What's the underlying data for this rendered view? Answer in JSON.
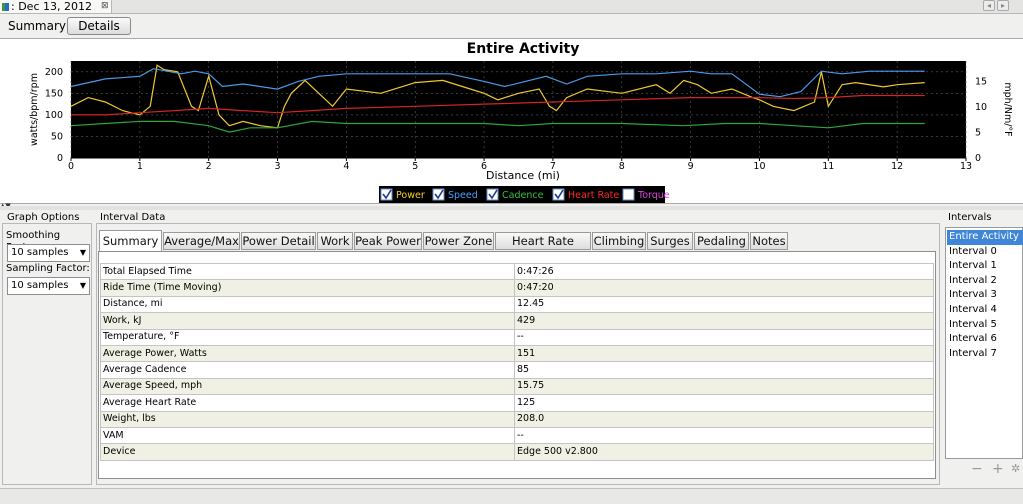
{
  "doc_tab": {
    "title": ": Dec 13, 2012",
    "close_glyph": "⊠"
  },
  "nav": {
    "back_glyph": "◂",
    "forward_glyph": "▸"
  },
  "view_toggle": {
    "summary_label": "Summary",
    "details_label": "Details"
  },
  "chart_data": {
    "type": "line",
    "title": "Entire Activity",
    "xlabel": "Distance (mi)",
    "ylabel_left": "watts/bpm/rpm",
    "ylabel_right": "mph/Nm/°F",
    "x_ticks": [
      0,
      1,
      2,
      3,
      4,
      5,
      6,
      7,
      8,
      9,
      10,
      11,
      12,
      13
    ],
    "y_left_ticks": [
      0,
      50,
      100,
      150,
      200
    ],
    "y_right_ticks": [
      0,
      5,
      10,
      15
    ],
    "xlim": [
      0,
      13
    ],
    "ylim_left": [
      0,
      225
    ],
    "ylim_right": [
      0,
      19
    ],
    "background": "#000000",
    "grid": true,
    "legend_placement": "bottom-center",
    "legend": [
      {
        "label": "Power",
        "checked": true,
        "color": "#f5d02a"
      },
      {
        "label": "Speed",
        "checked": true,
        "color": "#4aa0ff"
      },
      {
        "label": "Cadence",
        "checked": true,
        "color": "#32c040"
      },
      {
        "label": "Heart Rate",
        "checked": true,
        "color": "#ff2a2a"
      },
      {
        "label": "Torque",
        "checked": false,
        "color": "#e040e0"
      }
    ],
    "series": [
      {
        "name": "Power",
        "axis": "left",
        "color": "#f0c830",
        "x": [
          0,
          0.25,
          0.5,
          0.75,
          1.0,
          1.15,
          1.25,
          1.35,
          1.55,
          1.75,
          1.85,
          2.0,
          2.15,
          2.3,
          2.5,
          2.75,
          3.0,
          3.1,
          3.2,
          3.4,
          3.6,
          3.8,
          4.0,
          4.5,
          5.0,
          5.4,
          5.8,
          6.0,
          6.2,
          6.5,
          6.8,
          6.95,
          7.05,
          7.2,
          7.5,
          8.0,
          8.5,
          8.7,
          8.9,
          9.1,
          9.3,
          9.6,
          9.9,
          10.0,
          10.2,
          10.5,
          10.8,
          10.9,
          11.0,
          11.2,
          11.4,
          11.8,
          12.0,
          12.4
        ],
        "y": [
          120,
          140,
          130,
          110,
          100,
          120,
          215,
          205,
          200,
          120,
          110,
          190,
          100,
          75,
          85,
          75,
          70,
          120,
          150,
          180,
          150,
          120,
          160,
          150,
          175,
          180,
          160,
          150,
          135,
          150,
          160,
          120,
          110,
          140,
          160,
          150,
          170,
          150,
          180,
          170,
          150,
          160,
          140,
          135,
          120,
          110,
          130,
          200,
          120,
          170,
          175,
          165,
          170,
          175
        ]
      },
      {
        "name": "Speed",
        "axis": "right",
        "color": "#4a9ae8",
        "x": [
          0,
          0.5,
          1.0,
          1.2,
          1.4,
          1.6,
          1.8,
          2.0,
          2.2,
          2.5,
          3.0,
          3.3,
          3.6,
          4.0,
          4.5,
          5.0,
          5.5,
          6.0,
          6.3,
          6.6,
          6.9,
          7.2,
          7.5,
          8.0,
          8.5,
          9.0,
          9.3,
          9.6,
          10.0,
          10.3,
          10.6,
          10.9,
          11.2,
          11.6,
          12.0,
          12.4
        ],
        "y": [
          14,
          15.5,
          16,
          17.5,
          17,
          16.5,
          17,
          16.5,
          14,
          14.5,
          13.5,
          15,
          16,
          16.5,
          16.5,
          16.5,
          16.5,
          15,
          14,
          15,
          16,
          14.5,
          16,
          16.5,
          16.5,
          17,
          16.5,
          16.5,
          12.5,
          12,
          13,
          17,
          16.5,
          17,
          17,
          17
        ]
      },
      {
        "name": "Cadence",
        "axis": "left",
        "color": "#2ca63a",
        "x": [
          0,
          0.5,
          1.0,
          1.5,
          2.0,
          2.3,
          2.6,
          3.0,
          3.5,
          4.0,
          5.0,
          6.0,
          6.5,
          7.0,
          7.5,
          8.0,
          8.9,
          9.5,
          10.0,
          10.5,
          11.0,
          11.5,
          12.4
        ],
        "y": [
          75,
          80,
          85,
          85,
          75,
          60,
          70,
          70,
          85,
          80,
          80,
          80,
          75,
          80,
          80,
          80,
          75,
          80,
          80,
          75,
          70,
          80,
          80
        ]
      },
      {
        "name": "Heart Rate",
        "axis": "left",
        "color": "#d42424",
        "x": [
          0,
          0.5,
          1.0,
          1.5,
          2.0,
          2.5,
          3.0,
          3.5,
          4.0,
          5.0,
          6.0,
          7.0,
          8.0,
          9.0,
          10.0,
          10.5,
          11.0,
          11.5,
          12.0,
          12.4
        ],
        "y": [
          100,
          100,
          105,
          110,
          115,
          110,
          105,
          110,
          115,
          120,
          125,
          130,
          135,
          140,
          140,
          138,
          140,
          145,
          145,
          145
        ]
      }
    ]
  },
  "graph_options": {
    "header": "Graph Options",
    "smoothing_label": "Smoothing Factor:",
    "smoothing_value": "10 samples",
    "sampling_label": "Sampling Factor:",
    "sampling_value": "10 samples"
  },
  "interval_data": {
    "header": "Interval Data",
    "tabs": [
      "Summary",
      "Average/Max",
      "Power Detail",
      "Work",
      "Peak Power",
      "Power Zone",
      "Heart Rate Zone",
      "Climbing",
      "Surges",
      "Pedaling",
      "Notes"
    ],
    "rows": [
      {
        "label": "Total Elapsed Time",
        "value": "0:47:26"
      },
      {
        "label": "Ride Time (Time Moving)",
        "value": "0:47:20"
      },
      {
        "label": "Distance, mi",
        "value": "12.45"
      },
      {
        "label": "Work, kJ",
        "value": "429"
      },
      {
        "label": "Temperature, °F",
        "value": "--"
      },
      {
        "label": "Average Power, Watts",
        "value": "151"
      },
      {
        "label": "Average Cadence",
        "value": "85"
      },
      {
        "label": "Average Speed, mph",
        "value": "15.75"
      },
      {
        "label": "Average Heart Rate",
        "value": "125"
      },
      {
        "label": "Weight, lbs",
        "value": "208.0"
      },
      {
        "label": "VAM",
        "value": "--"
      },
      {
        "label": "Device",
        "value": "Edge 500 v2.800"
      }
    ]
  },
  "intervals": {
    "header": "Intervals",
    "items": [
      "Entire Activity",
      "Interval 0",
      "Interval 1",
      "Interval 2",
      "Interval 3",
      "Interval 4",
      "Interval 5",
      "Interval 6",
      "Interval 7"
    ],
    "selected": 0,
    "remove_glyph": "−",
    "add_glyph": "+"
  }
}
